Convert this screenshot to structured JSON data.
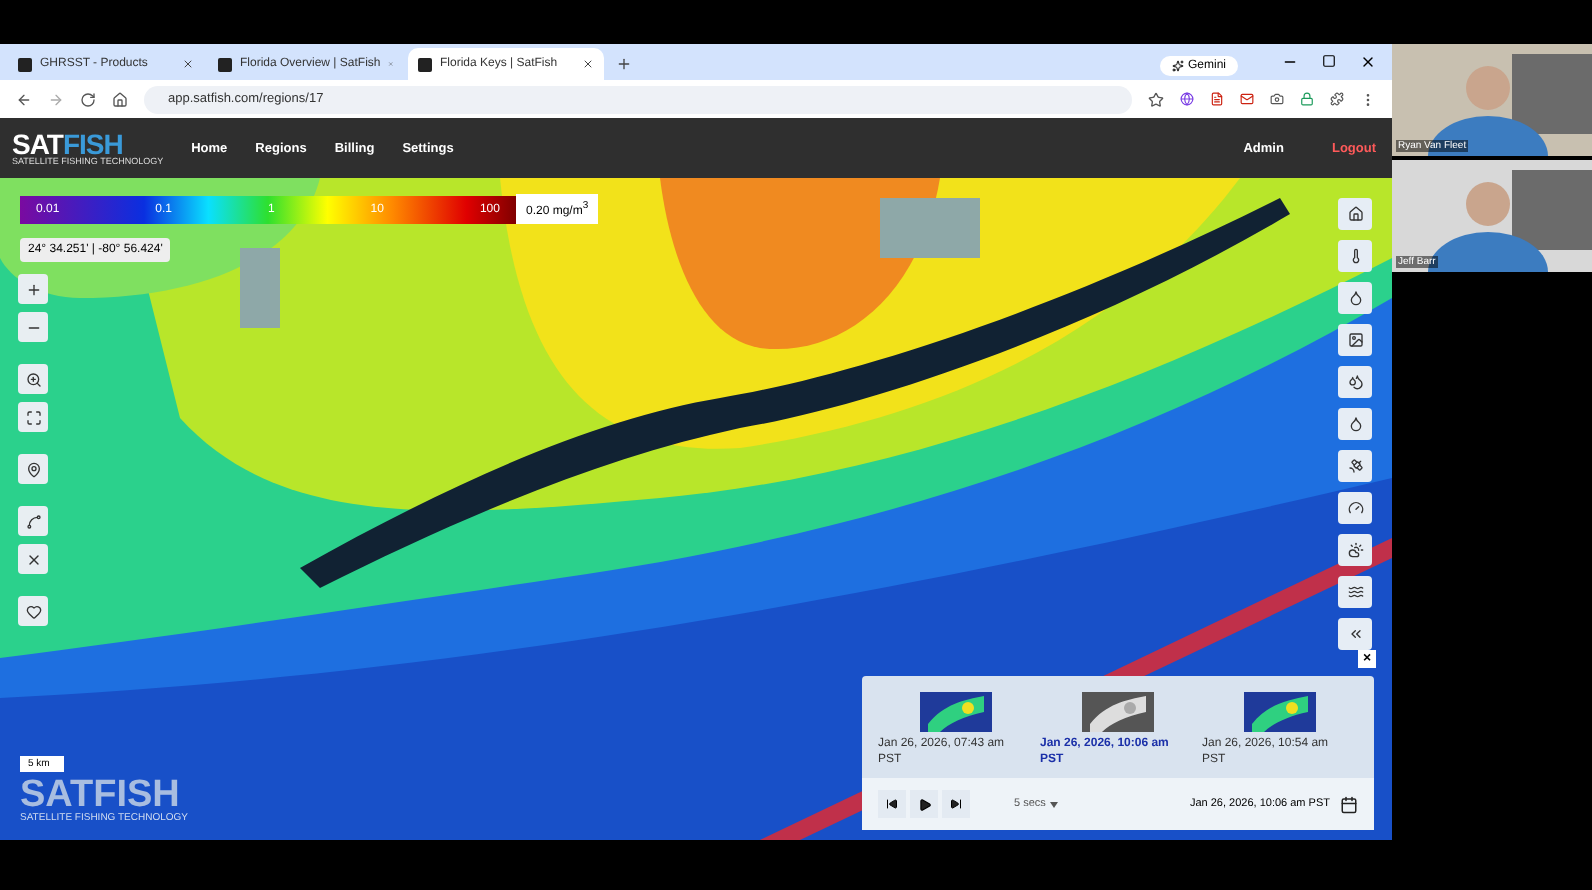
{
  "browser": {
    "tabs": [
      {
        "label": "GHRSST - Products",
        "selected": false
      },
      {
        "label": "Florida Overview | SatFish",
        "selected": false
      },
      {
        "label": "Florida Keys | SatFish",
        "selected": true
      }
    ],
    "gemini": "Gemini",
    "url": "app.satfish.com/regions/17"
  },
  "app": {
    "logo": {
      "first": "SAT",
      "second": "FISH",
      "tagline": "SATELLITE FISHING TECHNOLOGY"
    },
    "nav": [
      "Home",
      "Regions",
      "Billing",
      "Settings"
    ],
    "user": "Admin",
    "logout": "Logout"
  },
  "map": {
    "legend": {
      "ticks": [
        "0.01",
        "0.1",
        "1",
        "10",
        "100"
      ],
      "unit": "0.20 mg/m$^{3}$"
    },
    "coordinates": "24° 34.251' | -80° 56.424'",
    "scale": "5 km",
    "watermark": {
      "first": "SAT",
      "second": "FISH",
      "tagline": "SATELLITE FISHING TECHNOLOGY"
    }
  },
  "timeline": {
    "close": "×",
    "frames": [
      {
        "date": "Jan 26, 2026, 07:43 am",
        "zone": "PST",
        "selected": false
      },
      {
        "date": "Jan 26, 2026, 10:06 am",
        "zone": "PST",
        "selected": true
      },
      {
        "date": "Jan 26, 2026, 10:54 am",
        "zone": "PST",
        "selected": false
      }
    ],
    "speed": "5 secs",
    "current": "Jan 26, 2026, 10:06 am PST"
  },
  "participants": [
    {
      "name": "Ryan Van Fleet"
    },
    {
      "name": "Jeff Barr"
    }
  ]
}
